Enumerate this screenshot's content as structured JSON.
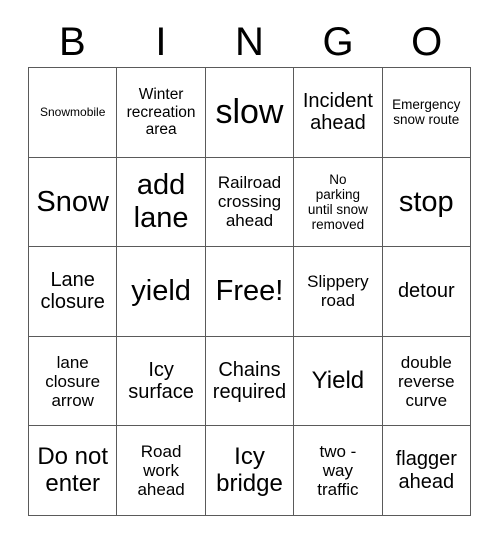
{
  "card": {
    "header_letters": [
      "B",
      "I",
      "N",
      "G",
      "O"
    ],
    "columns": 5,
    "rows": 5,
    "grid_border_color": "#5a5a5a",
    "background_color": "#ffffff",
    "text_color": "#000000",
    "cells": [
      {
        "text": "Snowmobile",
        "size": "fs-xs"
      },
      {
        "text": "Winter\nrecreation\narea",
        "size": "fs-m"
      },
      {
        "text": "slow",
        "size": "fs-huge"
      },
      {
        "text": "Incident\nahead",
        "size": "fs-l"
      },
      {
        "text": "Emergency\nsnow route",
        "size": "fs-s"
      },
      {
        "text": "Snow",
        "size": "fs-xxl"
      },
      {
        "text": "add\nlane",
        "size": "fs-xxl"
      },
      {
        "text": "Railroad\ncrossing\nahead",
        "size": "fs-ml"
      },
      {
        "text": "No\nparking\nuntil snow\nremoved",
        "size": "fs-s"
      },
      {
        "text": "stop",
        "size": "fs-xxl"
      },
      {
        "text": "Lane\nclosure",
        "size": "fs-l"
      },
      {
        "text": "yield",
        "size": "fs-xxl"
      },
      {
        "text": "Free!",
        "size": "fs-xxl"
      },
      {
        "text": "Slippery\nroad",
        "size": "fs-ml"
      },
      {
        "text": "detour",
        "size": "fs-l"
      },
      {
        "text": "lane\nclosure\narrow",
        "size": "fs-ml"
      },
      {
        "text": "Icy\nsurface",
        "size": "fs-l"
      },
      {
        "text": "Chains\nrequired",
        "size": "fs-l"
      },
      {
        "text": "Yield",
        "size": "fs-xl"
      },
      {
        "text": "double\nreverse\ncurve",
        "size": "fs-ml"
      },
      {
        "text": "Do not\nenter",
        "size": "fs-xl"
      },
      {
        "text": "Road\nwork\nahead",
        "size": "fs-ml"
      },
      {
        "text": "Icy\nbridge",
        "size": "fs-xl"
      },
      {
        "text": "two -\nway\ntraffic",
        "size": "fs-ml"
      },
      {
        "text": "flagger\nahead",
        "size": "fs-l"
      }
    ]
  }
}
